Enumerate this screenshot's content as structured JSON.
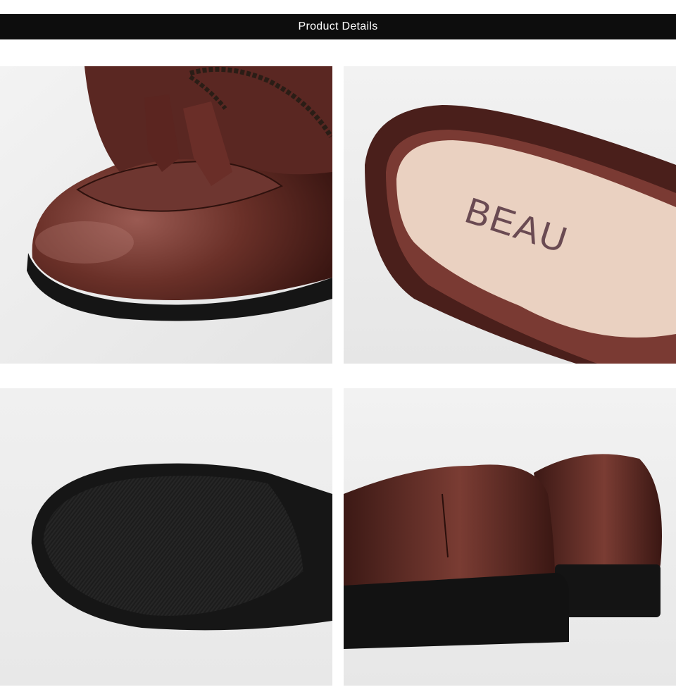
{
  "header": {
    "title": "Product Details",
    "background": "#0d0d0d",
    "text_color": "#ffffff"
  },
  "panels": [
    {
      "subject": "tassel loafer toe with rope lace",
      "name": "detail-toe-tassel"
    },
    {
      "subject": "leather insole with brand stamp",
      "name": "detail-insole",
      "brand_text": "BEAU"
    },
    {
      "subject": "black textured rubber outsole",
      "name": "detail-outsole"
    },
    {
      "subject": "heel counter of a pair of loafers",
      "name": "detail-heel"
    }
  ],
  "colors": {
    "leather": "#5a2a24",
    "leather_highlight": "#8a5048",
    "sole": "#1a1a1a",
    "insole": "#e9d2c3",
    "backdrop": "#eeeeee"
  }
}
